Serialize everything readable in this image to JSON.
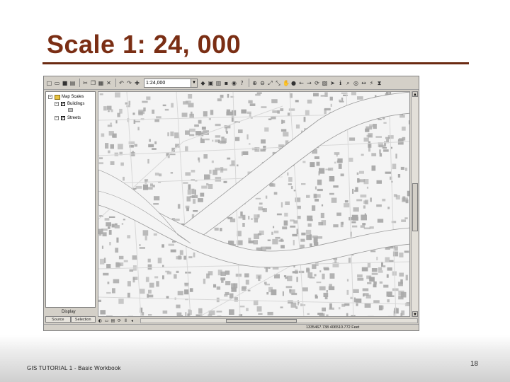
{
  "slide": {
    "title": "Scale 1: 24, 000",
    "footer": "GIS TUTORIAL 1 - Basic Workbook",
    "page_number": "18"
  },
  "app": {
    "toolbar": {
      "scale_value": "1:24,000"
    },
    "toc": {
      "root_label": "Map Scales",
      "layers": [
        {
          "label": "Buildings",
          "checked": true
        },
        {
          "label": "Streets",
          "checked": true
        }
      ],
      "display_label": "Display",
      "tabs": [
        {
          "label": "Source"
        },
        {
          "label": "Selection"
        }
      ]
    },
    "status": {
      "coordinates": "1335467.738  406510.772 Feet"
    },
    "colors": {
      "title": "#7a2e14",
      "rule": "#6b2a12",
      "building": "#a8a8a8",
      "street": "#ffffff",
      "map_bg": "#f4f4f4"
    }
  }
}
